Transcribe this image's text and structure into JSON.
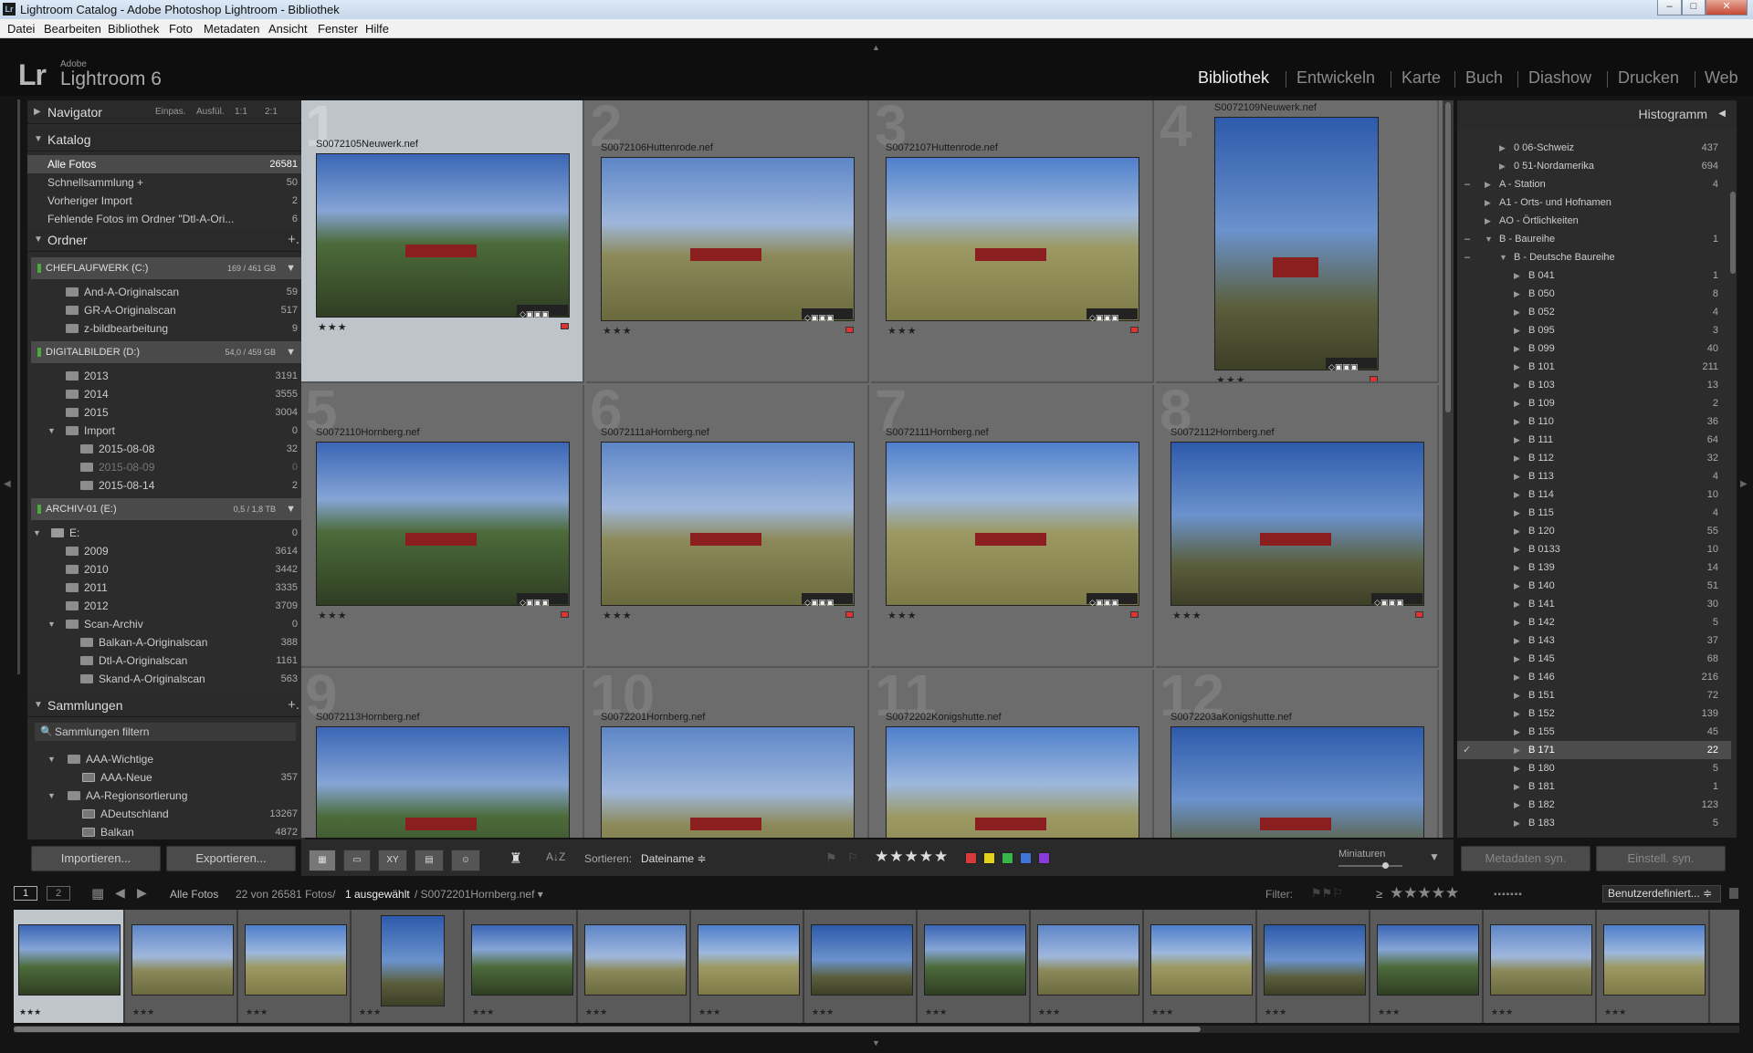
{
  "window": {
    "title": "Lightroom Catalog - Adobe Photoshop Lightroom - Bibliothek",
    "app_icon": "Lr",
    "minimize": "–",
    "maximize": "□",
    "close": "✕"
  },
  "menu": [
    "Datei",
    "Bearbeiten",
    "Bibliothek",
    "Foto",
    "Metadaten",
    "Ansicht",
    "Fenster",
    "Hilfe"
  ],
  "brand": {
    "logo": "Lr",
    "vendor": "Adobe",
    "product": "Lightroom 6"
  },
  "modules": [
    "Bibliothek",
    "Entwickeln",
    "Karte",
    "Buch",
    "Diashow",
    "Drucken",
    "Web"
  ],
  "active_module": "Bibliothek",
  "navigator": {
    "title": "Navigator",
    "options": [
      "Einpas.",
      "Ausfül.",
      "1:1",
      "2:1"
    ]
  },
  "catalog": {
    "title": "Katalog",
    "items": [
      {
        "label": "Alle Fotos",
        "count": "26581",
        "selected": true
      },
      {
        "label": "Schnellsammlung +",
        "count": "50"
      },
      {
        "label": "Vorheriger Import",
        "count": "2"
      },
      {
        "label": "Fehlende Fotos im Ordner \"Dtl-A-Ori...",
        "count": "6"
      }
    ]
  },
  "folders": {
    "title": "Ordner",
    "plus": "+.",
    "volumes": [
      {
        "name": "CHEFLAUFWERK (C:)",
        "size": "169 / 461 GB",
        "items": [
          {
            "label": "And-A-Originalscan",
            "count": "59",
            "level": 1
          },
          {
            "label": "GR-A-Originalscan",
            "count": "517",
            "level": 1
          },
          {
            "label": "z-bildbearbeitung",
            "count": "9",
            "level": 1
          }
        ]
      },
      {
        "name": "DIGITALBILDER (D:)",
        "size": "54,0 / 459 GB",
        "items": [
          {
            "label": "2013",
            "count": "3191",
            "level": 1
          },
          {
            "label": "2014",
            "count": "3555",
            "level": 1
          },
          {
            "label": "2015",
            "count": "3004",
            "level": 1
          },
          {
            "label": "Import",
            "count": "0",
            "level": 1,
            "open": true
          },
          {
            "label": "2015-08-08",
            "count": "32",
            "level": 2
          },
          {
            "label": "2015-08-09",
            "count": "0",
            "level": 2,
            "dim": true
          },
          {
            "label": "2015-08-14",
            "count": "2",
            "level": 2
          }
        ]
      },
      {
        "name": "ARCHIV-01 (E:)",
        "size": "0,5 / 1,8 TB",
        "items": [
          {
            "label": "E:",
            "count": "0",
            "level": 0,
            "open": true
          },
          {
            "label": "2009",
            "count": "3614",
            "level": 1
          },
          {
            "label": "2010",
            "count": "3442",
            "level": 1
          },
          {
            "label": "2011",
            "count": "3335",
            "level": 1
          },
          {
            "label": "2012",
            "count": "3709",
            "level": 1
          },
          {
            "label": "Scan-Archiv",
            "count": "0",
            "level": 1,
            "open": true
          },
          {
            "label": "Balkan-A-Originalscan",
            "count": "388",
            "level": 2
          },
          {
            "label": "Dtl-A-Originalscan",
            "count": "1161",
            "level": 2
          },
          {
            "label": "Skand-A-Originalscan",
            "count": "563",
            "level": 2
          }
        ]
      }
    ]
  },
  "collections": {
    "title": "Sammlungen",
    "plus": "+.",
    "filter_placeholder": "Sammlungen filtern",
    "items": [
      {
        "label": "AAA-Wichtige",
        "count": "",
        "level": 0,
        "set": true
      },
      {
        "label": "AAA-Neue",
        "count": "357",
        "level": 1
      },
      {
        "label": "AA-Regionsortierung",
        "count": "",
        "level": 0,
        "set": true
      },
      {
        "label": "ADeutschland",
        "count": "13267",
        "level": 1
      },
      {
        "label": "Balkan",
        "count": "4872",
        "level": 1
      }
    ]
  },
  "left_buttons": {
    "import": "Importieren...",
    "export": "Exportieren..."
  },
  "grid": [
    {
      "num": "1",
      "file": "S0072105Neuwerk.nef",
      "stars": "★★★",
      "selected": true,
      "portrait": false,
      "offset": 34
    },
    {
      "num": "2",
      "file": "S0072106Huttenrode.nef",
      "stars": "★★★",
      "portrait": false,
      "offset": 38
    },
    {
      "num": "3",
      "file": "S0072107Huttenrode.nef",
      "stars": "★★★",
      "portrait": false,
      "offset": 38
    },
    {
      "num": "4",
      "file": "S0072109Neuwerk.nef",
      "stars": "★★★",
      "portrait": true,
      "offset": 0
    },
    {
      "num": "5",
      "file": "S0072110Hornberg.nef",
      "stars": "★★★",
      "portrait": false,
      "offset": 38
    },
    {
      "num": "6",
      "file": "S0072111aHornberg.nef",
      "stars": "★★★",
      "portrait": false,
      "offset": 38
    },
    {
      "num": "7",
      "file": "S0072111Hornberg.nef",
      "stars": "★★★",
      "portrait": false,
      "offset": 38
    },
    {
      "num": "8",
      "file": "S0072112Hornberg.nef",
      "stars": "★★★",
      "portrait": false,
      "offset": 38
    },
    {
      "num": "9",
      "file": "S0072113Hornberg.nef",
      "stars": "",
      "portrait": false,
      "offset": 38
    },
    {
      "num": "10",
      "file": "S0072201Hornberg.nef",
      "stars": "",
      "portrait": false,
      "offset": 38
    },
    {
      "num": "11",
      "file": "S0072202Konigshutte.nef",
      "stars": "",
      "portrait": false,
      "offset": 38
    },
    {
      "num": "12",
      "file": "S0072203aKonigshutte.nef",
      "stars": "",
      "portrait": false,
      "offset": 38
    }
  ],
  "toolbar": {
    "sort_label": "Sortieren:",
    "sort_value": "Dateiname ≑",
    "stars": "★★★★★",
    "thumb_label": "Miniaturen",
    "az": "A↓Z"
  },
  "colors": {
    "accent": "#4caa3e",
    "red": "#d83a3a",
    "yellow": "#e2d21e",
    "green": "#38b54a",
    "blue": "#3f74d8",
    "purple": "#8a3ad8"
  },
  "histogram": {
    "title": "Histogramm"
  },
  "keywords": [
    {
      "label": "0 06-Schweiz",
      "count": "437",
      "level": 2
    },
    {
      "label": "0 51-Nordamerika",
      "count": "694",
      "level": 2
    },
    {
      "label": "A - Station",
      "count": "4",
      "level": 1,
      "minus": true
    },
    {
      "label": "A1 - Orts- und Hofnamen",
      "count": "",
      "level": 1
    },
    {
      "label": "AO - Örtlichkeiten",
      "count": "",
      "level": 1
    },
    {
      "label": "B - Baureihe",
      "count": "1",
      "level": 1,
      "minus": true,
      "open": true
    },
    {
      "label": "B - Deutsche Baureihe",
      "count": "",
      "level": 2,
      "minus": true,
      "open": true
    },
    {
      "label": "B 041",
      "count": "1",
      "level": 3
    },
    {
      "label": "B 050",
      "count": "8",
      "level": 3
    },
    {
      "label": "B 052",
      "count": "4",
      "level": 3
    },
    {
      "label": "B 095",
      "count": "3",
      "level": 3
    },
    {
      "label": "B 099",
      "count": "40",
      "level": 3
    },
    {
      "label": "B 101",
      "count": "211",
      "level": 3
    },
    {
      "label": "B 103",
      "count": "13",
      "level": 3
    },
    {
      "label": "B 109",
      "count": "2",
      "level": 3
    },
    {
      "label": "B 110",
      "count": "36",
      "level": 3
    },
    {
      "label": "B 111",
      "count": "64",
      "level": 3
    },
    {
      "label": "B 112",
      "count": "32",
      "level": 3
    },
    {
      "label": "B 113",
      "count": "4",
      "level": 3
    },
    {
      "label": "B 114",
      "count": "10",
      "level": 3
    },
    {
      "label": "B 115",
      "count": "4",
      "level": 3
    },
    {
      "label": "B 120",
      "count": "55",
      "level": 3
    },
    {
      "label": "B 0133",
      "count": "10",
      "level": 3,
      "arrow": true
    },
    {
      "label": "B 139",
      "count": "14",
      "level": 3
    },
    {
      "label": "B 140",
      "count": "51",
      "level": 3
    },
    {
      "label": "B 141",
      "count": "30",
      "level": 3
    },
    {
      "label": "B 142",
      "count": "5",
      "level": 3
    },
    {
      "label": "B 143",
      "count": "37",
      "level": 3
    },
    {
      "label": "B 145",
      "count": "68",
      "level": 3
    },
    {
      "label": "B 146",
      "count": "216",
      "level": 3
    },
    {
      "label": "B 151",
      "count": "72",
      "level": 3
    },
    {
      "label": "B 152",
      "count": "139",
      "level": 3
    },
    {
      "label": "B 155",
      "count": "45",
      "level": 3
    },
    {
      "label": "B 171",
      "count": "22",
      "level": 3,
      "selected": true,
      "check": true
    },
    {
      "label": "B 180",
      "count": "5",
      "level": 3
    },
    {
      "label": "B 181",
      "count": "1",
      "level": 3
    },
    {
      "label": "B 182",
      "count": "123",
      "level": 3
    },
    {
      "label": "B 183",
      "count": "5",
      "level": 3
    }
  ],
  "right_buttons": {
    "meta": "Metadaten syn.",
    "settings": "Einstell. syn."
  },
  "filmstrip_bar": {
    "page1": "1",
    "page2": "2",
    "source": "Alle Fotos",
    "count": "22 von 26581 Fotos/",
    "selected": "1 ausgewählt",
    "file": "/ S0072201Hornberg.nef ▾",
    "filter_label": "Filter:",
    "filter_ge": "≥",
    "filter_stars": "★★★★★",
    "filter_preset": "Benutzerdefiniert... ≑"
  },
  "filmstrip_stars": "★★★"
}
